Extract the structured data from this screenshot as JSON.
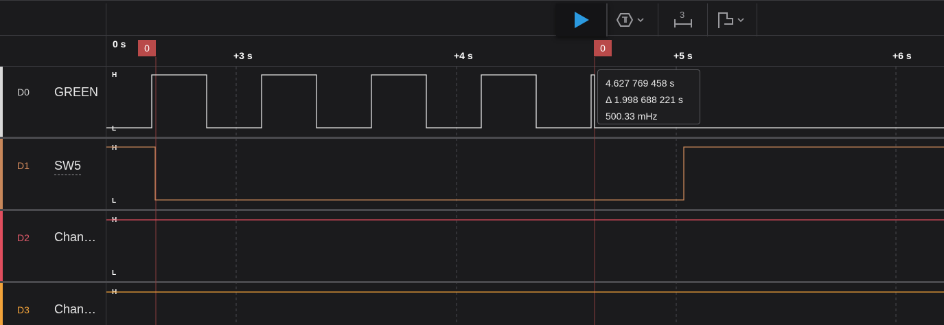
{
  "toolbar": {
    "buttons": [
      {
        "name": "play-button",
        "icon": "play-icon"
      },
      {
        "name": "trigger-button",
        "icon": "trigger-icon"
      },
      {
        "name": "measure-button",
        "icon": "measure-icon",
        "label": "3"
      },
      {
        "name": "marker-button",
        "icon": "marker-flag-icon"
      }
    ]
  },
  "timeline": {
    "start_label": "0 s",
    "ticks": [
      "+3 s",
      "+4 s",
      "+5 s",
      "+6 s"
    ],
    "markers": [
      "0",
      "0"
    ]
  },
  "channels": [
    {
      "id": "D0",
      "name": "GREEN",
      "color": "#d9d9d9",
      "id_color": "#cfcfcf",
      "high": "H",
      "low": "L"
    },
    {
      "id": "D1",
      "name": "SW5",
      "color": "#c8875a",
      "id_color": "#d38a5c",
      "high": "H",
      "low": "L"
    },
    {
      "id": "D2",
      "name": "Chan…",
      "color": "#e04e5e",
      "id_color": "#e35b6b",
      "high": "H",
      "low": "L"
    },
    {
      "id": "D3",
      "name": "Chan…",
      "color": "#f2a33a",
      "id_color": "#f2a33a",
      "high": "H"
    }
  ],
  "tooltip": {
    "time": "4.627 769 458 s",
    "delta": "Δ 1.998 688 221 s",
    "frequency": "500.33 mHz"
  },
  "colors": {
    "accent": "#2b9ae0",
    "marker": "#b94a4a",
    "background": "#1b1b1d"
  }
}
